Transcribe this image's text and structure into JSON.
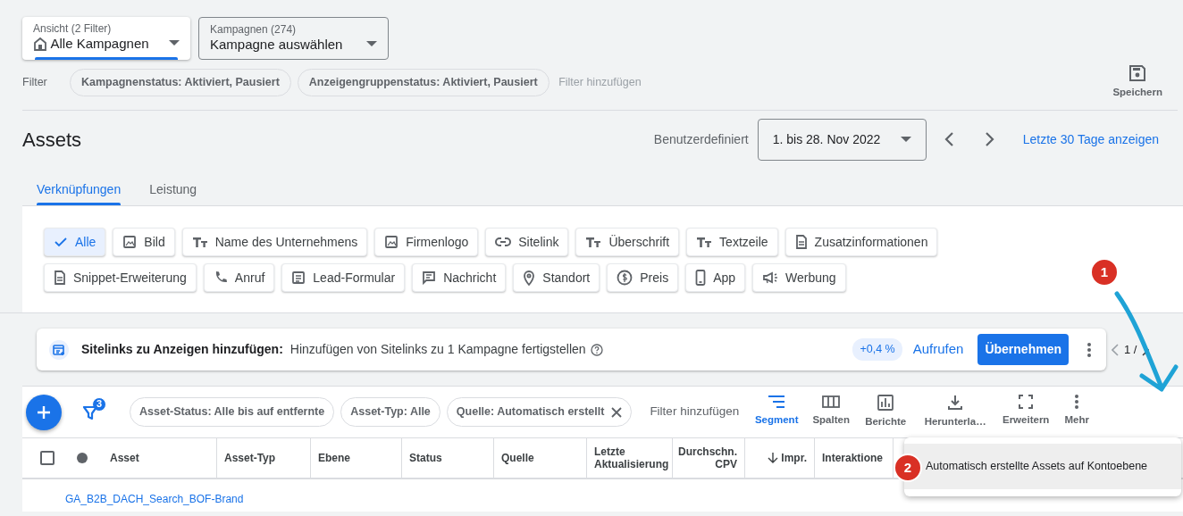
{
  "view_selector": {
    "label": "Ansicht (2 Filter)",
    "value": "Alle Kampagnen"
  },
  "campaign_selector": {
    "label": "Kampagnen (274)",
    "value": "Kampagne auswählen"
  },
  "filter_bar": {
    "label": "Filter",
    "chips": [
      "Kampagnenstatus: Aktiviert, Pausiert",
      "Anzeigengruppenstatus: Aktiviert, Pausiert"
    ],
    "add_filter": "Filter hinzufügen",
    "save": "Speichern"
  },
  "page_title": "Assets",
  "date_range": {
    "label": "Benutzerdefiniert",
    "value": "1. bis 28. Nov 2022",
    "link": "Letzte 30 Tage anzeigen"
  },
  "tabs": [
    {
      "label": "Verknüpfungen",
      "selected": true
    },
    {
      "label": "Leistung",
      "selected": false
    }
  ],
  "asset_types": [
    {
      "label": "Alle",
      "kind": "all",
      "selected": true
    },
    {
      "label": "Bild",
      "kind": "image",
      "selected": false
    },
    {
      "label": "Name des Unternehmens",
      "kind": "text",
      "selected": false
    },
    {
      "label": "Firmenlogo",
      "kind": "image",
      "selected": false
    },
    {
      "label": "Sitelink",
      "kind": "link",
      "selected": false
    },
    {
      "label": "Überschrift",
      "kind": "text",
      "selected": false
    },
    {
      "label": "Textzeile",
      "kind": "text",
      "selected": false
    },
    {
      "label": "Zusatzinformationen",
      "kind": "doc",
      "selected": false
    },
    {
      "label": "Snippet-Erweiterung",
      "kind": "doc",
      "selected": false
    },
    {
      "label": "Anruf",
      "kind": "phone",
      "selected": false
    },
    {
      "label": "Lead-Formular",
      "kind": "form",
      "selected": false
    },
    {
      "label": "Nachricht",
      "kind": "message",
      "selected": false
    },
    {
      "label": "Standort",
      "kind": "pin",
      "selected": false
    },
    {
      "label": "Preis",
      "kind": "price",
      "selected": false
    },
    {
      "label": "App",
      "kind": "mobile",
      "selected": false
    },
    {
      "label": "Werbung",
      "kind": "megaphone",
      "selected": false
    }
  ],
  "recommendation": {
    "title": "Sitelinks zu Anzeigen hinzufügen:",
    "text": "Hinzufügen von Sitelinks zu 1 Kampagne fertigstellen",
    "uplift": "+0,4 %",
    "view": "Aufrufen",
    "apply": "Übernehmen",
    "pager": "1 /"
  },
  "table_toolbar": {
    "filter_count": "3",
    "chips": [
      {
        "label": "Asset-Status: Alle bis auf entfernte",
        "removable": false
      },
      {
        "label": "Asset-Typ: Alle",
        "removable": false
      },
      {
        "label": "Quelle: Automatisch erstellt",
        "removable": true
      }
    ],
    "add_filter": "Filter hinzufügen",
    "actions": [
      {
        "label": "Segment",
        "kind": "segment",
        "selected": true
      },
      {
        "label": "Spalten",
        "kind": "columns",
        "selected": false
      },
      {
        "label": "Berichte",
        "kind": "report",
        "selected": false
      },
      {
        "label": "Herunterla…",
        "kind": "download",
        "selected": false
      },
      {
        "label": "Erweitern",
        "kind": "expand",
        "selected": false
      },
      {
        "label": "Mehr",
        "kind": "more",
        "selected": false
      }
    ]
  },
  "table": {
    "select_all_checked": false,
    "columns": [
      {
        "label": "Asset",
        "sorted": false
      },
      {
        "label": "Asset-Typ",
        "sorted": false
      },
      {
        "label": "Ebene",
        "sorted": false
      },
      {
        "label": "Status",
        "sorted": false
      },
      {
        "label": "Quelle",
        "sorted": false
      },
      {
        "label": "Letzte Aktualisierung",
        "sorted": false
      },
      {
        "label": "Durchschn. CPV",
        "sorted": false
      },
      {
        "label": "Impr.",
        "sorted": true
      },
      {
        "label": "Interaktione",
        "sorted": false
      }
    ],
    "rows": [
      {
        "asset": "GA_B2B_DACH_Search_BOF-Brand"
      }
    ]
  },
  "menu": {
    "items": [
      "Automatisch erstellte Assets auf Kontoebene"
    ]
  },
  "annotations": [
    {
      "number": "1"
    },
    {
      "number": "2"
    }
  ]
}
